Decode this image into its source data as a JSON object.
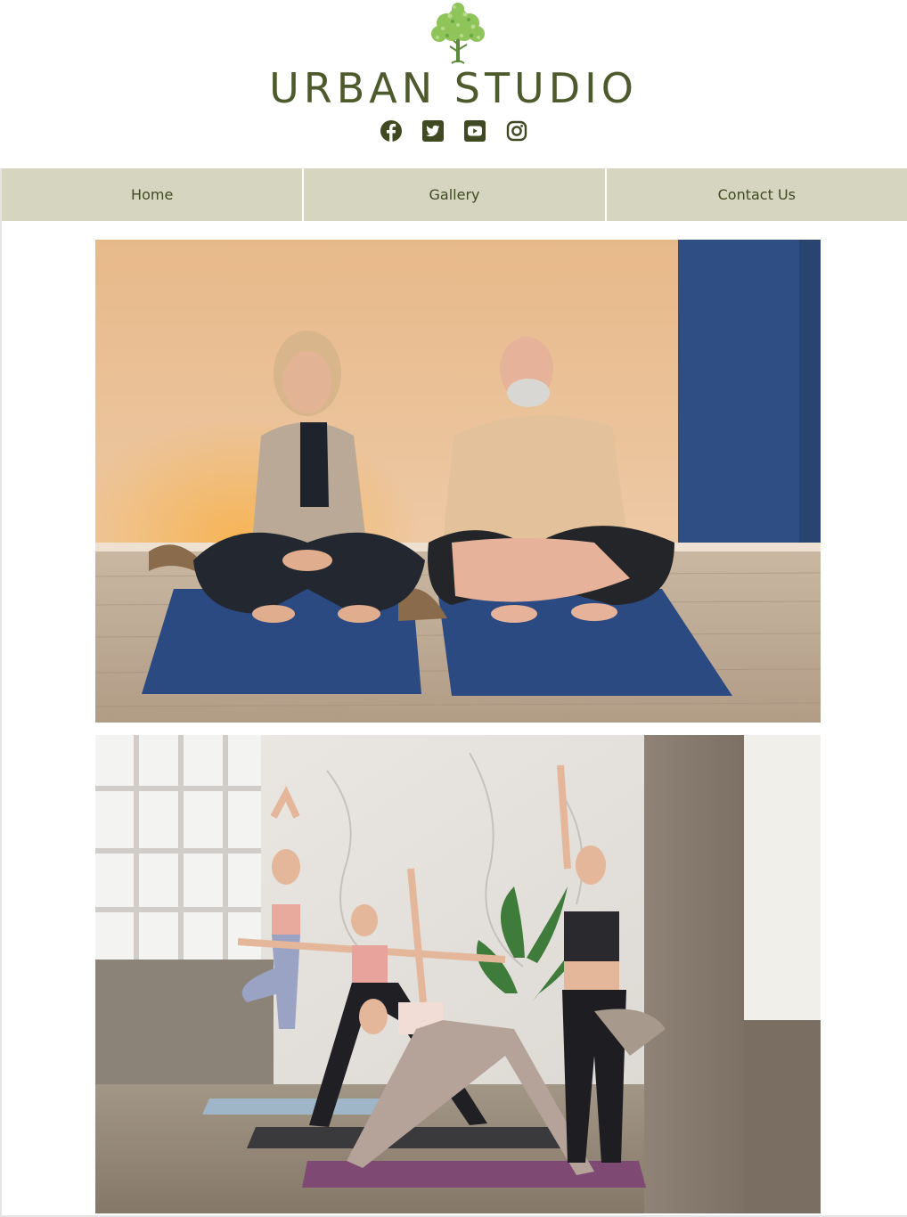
{
  "brand": {
    "title": "URBAN STUDIO",
    "logo_icon": "tree-logo-icon",
    "color": "#4c5a2c"
  },
  "social": {
    "icons": [
      "facebook-icon",
      "twitter-icon",
      "youtube-icon",
      "instagram-icon"
    ]
  },
  "nav": {
    "items": [
      {
        "label": "Home"
      },
      {
        "label": "Gallery"
      },
      {
        "label": "Contact Us"
      }
    ],
    "background": "#d6d5bf",
    "text_color": "#3f4a23"
  },
  "gallery": {
    "photos": [
      {
        "subject": "couple-meditating-photo"
      },
      {
        "subject": "group-yoga-class-photo"
      }
    ]
  }
}
